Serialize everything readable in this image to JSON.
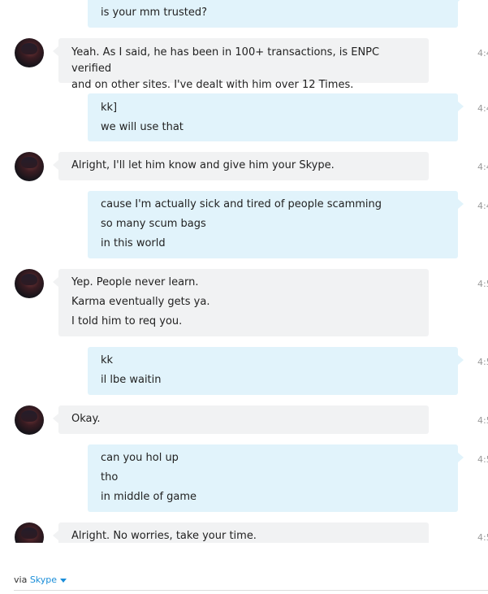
{
  "messages": [
    {
      "dir": "out",
      "lines": [
        "is your mm trusted?"
      ],
      "time": ""
    },
    {
      "dir": "in",
      "lines": [
        "Yeah. As I said, he has been in 100+ transactions, is ENPC verified",
        "and on other sites. I've dealt with him over 12 Times."
      ],
      "time": "4:4"
    },
    {
      "dir": "out",
      "lines": [
        "kk]",
        "we will use that"
      ],
      "time": "4:4"
    },
    {
      "dir": "in",
      "lines": [
        "Alright, I'll let him know and give him your Skype."
      ],
      "time": "4:4"
    },
    {
      "dir": "out",
      "lines": [
        "cause I'm actually sick and tired of people scamming",
        "so many scum bags",
        "in this world"
      ],
      "time": "4:4"
    },
    {
      "dir": "in",
      "lines": [
        "Yep. People never learn.",
        "Karma eventually gets ya.",
        "I told him to req you."
      ],
      "time": "4:5"
    },
    {
      "dir": "out",
      "lines": [
        "kk",
        "il lbe waitin"
      ],
      "time": "4:5"
    },
    {
      "dir": "in",
      "lines": [
        "Okay."
      ],
      "time": "4:5"
    },
    {
      "dir": "out",
      "lines": [
        "can you hol up",
        "tho",
        "in middle of game"
      ],
      "time": "4:5"
    },
    {
      "dir": "in",
      "lines": [
        "Alright. No worries, take your time."
      ],
      "time": "4:5"
    }
  ],
  "footer": {
    "via_text": "via",
    "link_text": "Skype"
  }
}
